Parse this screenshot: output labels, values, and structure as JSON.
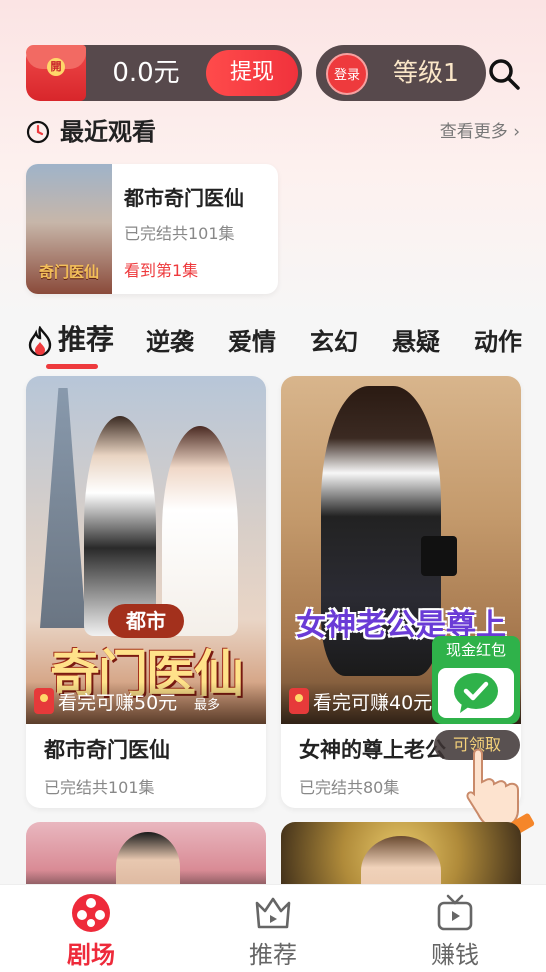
{
  "header": {
    "wallet_seal": "開",
    "balance": "0.0元",
    "withdraw_label": "提现",
    "login_label": "登录",
    "level_label": "等级1"
  },
  "recent": {
    "title": "最近观看",
    "see_more": "查看更多",
    "item": {
      "cover_text": "奇门医仙",
      "name": "都市奇门医仙",
      "episodes": "已完结共101集",
      "progress": "看到第1集"
    }
  },
  "tabs": [
    "推荐",
    "逆袭",
    "爱情",
    "玄幻",
    "悬疑",
    "动作"
  ],
  "cards": [
    {
      "poster_sub": "都市",
      "poster_title": "奇门医仙",
      "earn": "看完可赚50元",
      "earn_max": "最多",
      "title": "都市奇门医仙",
      "episodes": "已完结共101集"
    },
    {
      "poster_title": "女神老公是尊上",
      "earn": "看完可赚40元",
      "title": "女神的尊上老公",
      "episodes": "已完结共80集"
    }
  ],
  "cash_widget": {
    "label": "现金红包",
    "claim": "可领取"
  },
  "bottom_nav": [
    {
      "label": "剧场",
      "active": true
    },
    {
      "label": "推荐",
      "active": false
    },
    {
      "label": "赚钱",
      "active": false
    }
  ],
  "colors": {
    "accent": "#ee3a3d",
    "pill": "#57494c",
    "wechat_green": "#2fb24a"
  }
}
